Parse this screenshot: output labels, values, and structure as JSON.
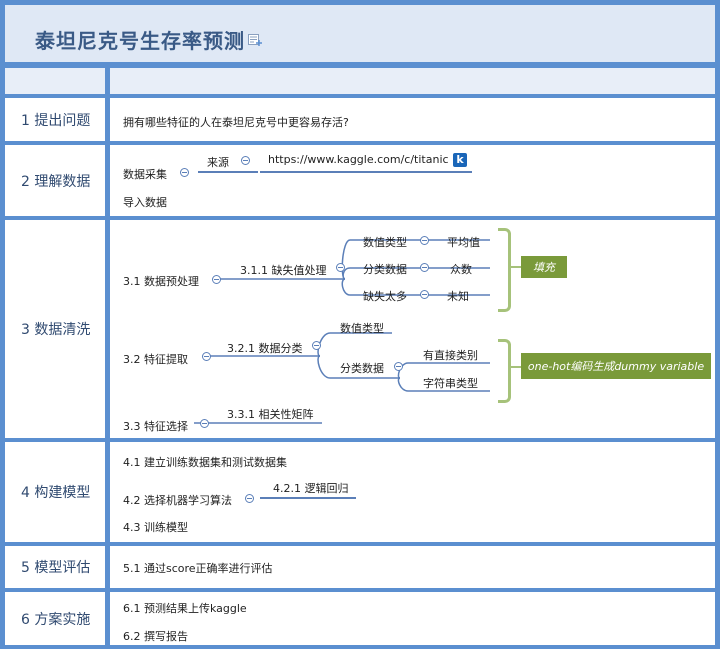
{
  "title": "泰坦尼克号生存率预测",
  "rows": [
    {
      "label": "1 提出问题"
    },
    {
      "label": "2 理解数据"
    },
    {
      "label": "3 数据清洗"
    },
    {
      "label": "4 构建模型"
    },
    {
      "label": "5 模型评估"
    },
    {
      "label": "6 方案实施"
    }
  ],
  "r1": {
    "question": "拥有哪些特征的人在泰坦尼克号中更容易存活?"
  },
  "r2": {
    "collect": "数据采集",
    "source": "来源",
    "url": "https://www.kaggle.com/c/titanic",
    "k": "k",
    "import": "导入数据"
  },
  "r3": {
    "pre": "3.1 数据预处理",
    "missing": "3.1.1 缺失值处理",
    "numtype": "数值类型",
    "mean": "平均值",
    "cat": "分类数据",
    "mode": "众数",
    "toomany": "缺失太多",
    "unknown": "未知",
    "fill": "填充",
    "feat": "3.2 特征提取",
    "cls": "3.2.1 数据分类",
    "numtype2": "数值类型",
    "cat2": "分类数据",
    "direct": "有直接类别",
    "str": "字符串类型",
    "onehot": "one-hot编码生成dummy variable",
    "sel": "3.3 特征选择",
    "corr": "3.3.1 相关性矩阵"
  },
  "r4": {
    "a": "4.1 建立训练数据集和测试数据集",
    "b": "4.2 选择机器学习算法",
    "b1": "4.2.1 逻辑回归",
    "c": "4.3 训练模型"
  },
  "r5": {
    "a": "5.1 通过score正确率进行评估"
  },
  "r6": {
    "a": "6.1 预测结果上传kaggle",
    "b": "6.2 撰写报告"
  }
}
